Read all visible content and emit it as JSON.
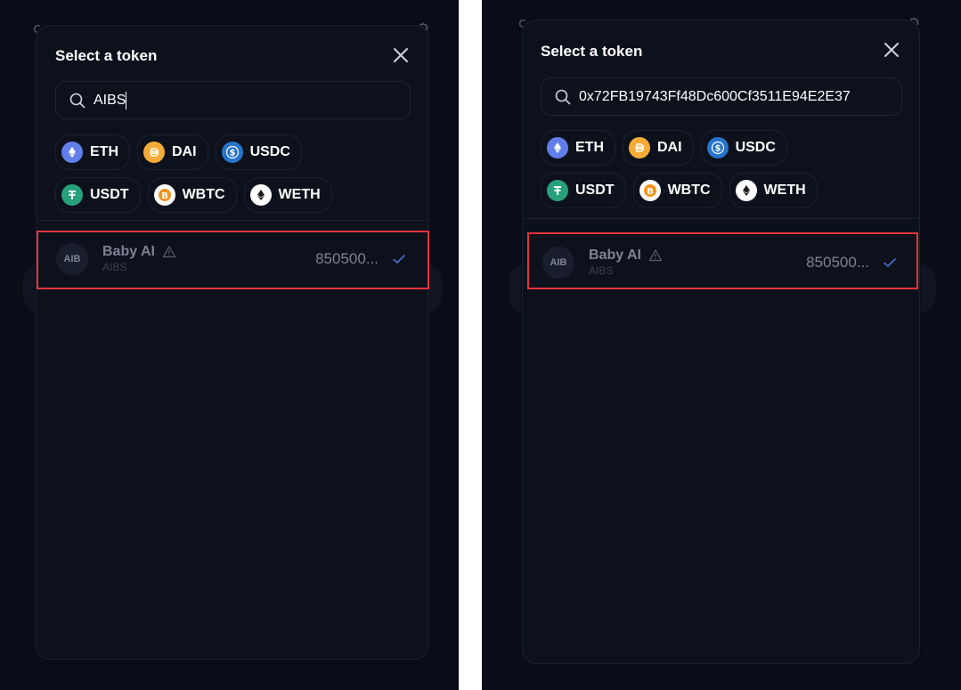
{
  "modal": {
    "title": "Select a token",
    "close_icon": "close-icon"
  },
  "panels": [
    {
      "search": {
        "value": "AIBS",
        "icon": "search-icon"
      },
      "common_tokens": [
        {
          "symbol": "ETH",
          "icon": "eth-icon",
          "color": "#627eea"
        },
        {
          "symbol": "DAI",
          "icon": "dai-icon",
          "color": "#f5ac37"
        },
        {
          "symbol": "USDC",
          "icon": "usdc-icon",
          "color": "#2775ca"
        },
        {
          "symbol": "USDT",
          "icon": "usdt-icon",
          "color": "#26a17b"
        },
        {
          "symbol": "WBTC",
          "icon": "wbtc-icon",
          "color": "#f7931a"
        },
        {
          "symbol": "WETH",
          "icon": "weth-icon",
          "color": "#ffffff"
        }
      ],
      "results": [
        {
          "avatar": "AIB",
          "name": "Baby AI",
          "symbol": "AIBS",
          "balance": "850500...",
          "selected": true
        }
      ]
    },
    {
      "search": {
        "value": "0x72FB19743Ff48Dc600Cf3511E94E2E37",
        "icon": "search-icon"
      },
      "common_tokens": [
        {
          "symbol": "ETH",
          "icon": "eth-icon",
          "color": "#627eea"
        },
        {
          "symbol": "DAI",
          "icon": "dai-icon",
          "color": "#f5ac37"
        },
        {
          "symbol": "USDC",
          "icon": "usdc-icon",
          "color": "#2775ca"
        },
        {
          "symbol": "USDT",
          "icon": "usdt-icon",
          "color": "#26a17b"
        },
        {
          "symbol": "WBTC",
          "icon": "wbtc-icon",
          "color": "#f7931a"
        },
        {
          "symbol": "WETH",
          "icon": "weth-icon",
          "color": "#ffffff"
        }
      ],
      "results": [
        {
          "avatar": "AIB",
          "name": "Baby AI",
          "symbol": "AIBS",
          "balance": "850500...",
          "selected": true
        }
      ]
    }
  ],
  "colors": {
    "background": "#0a0d17",
    "modal": "#0d111c",
    "highlight": "#e5343b",
    "muted_text": "#7d8393"
  }
}
